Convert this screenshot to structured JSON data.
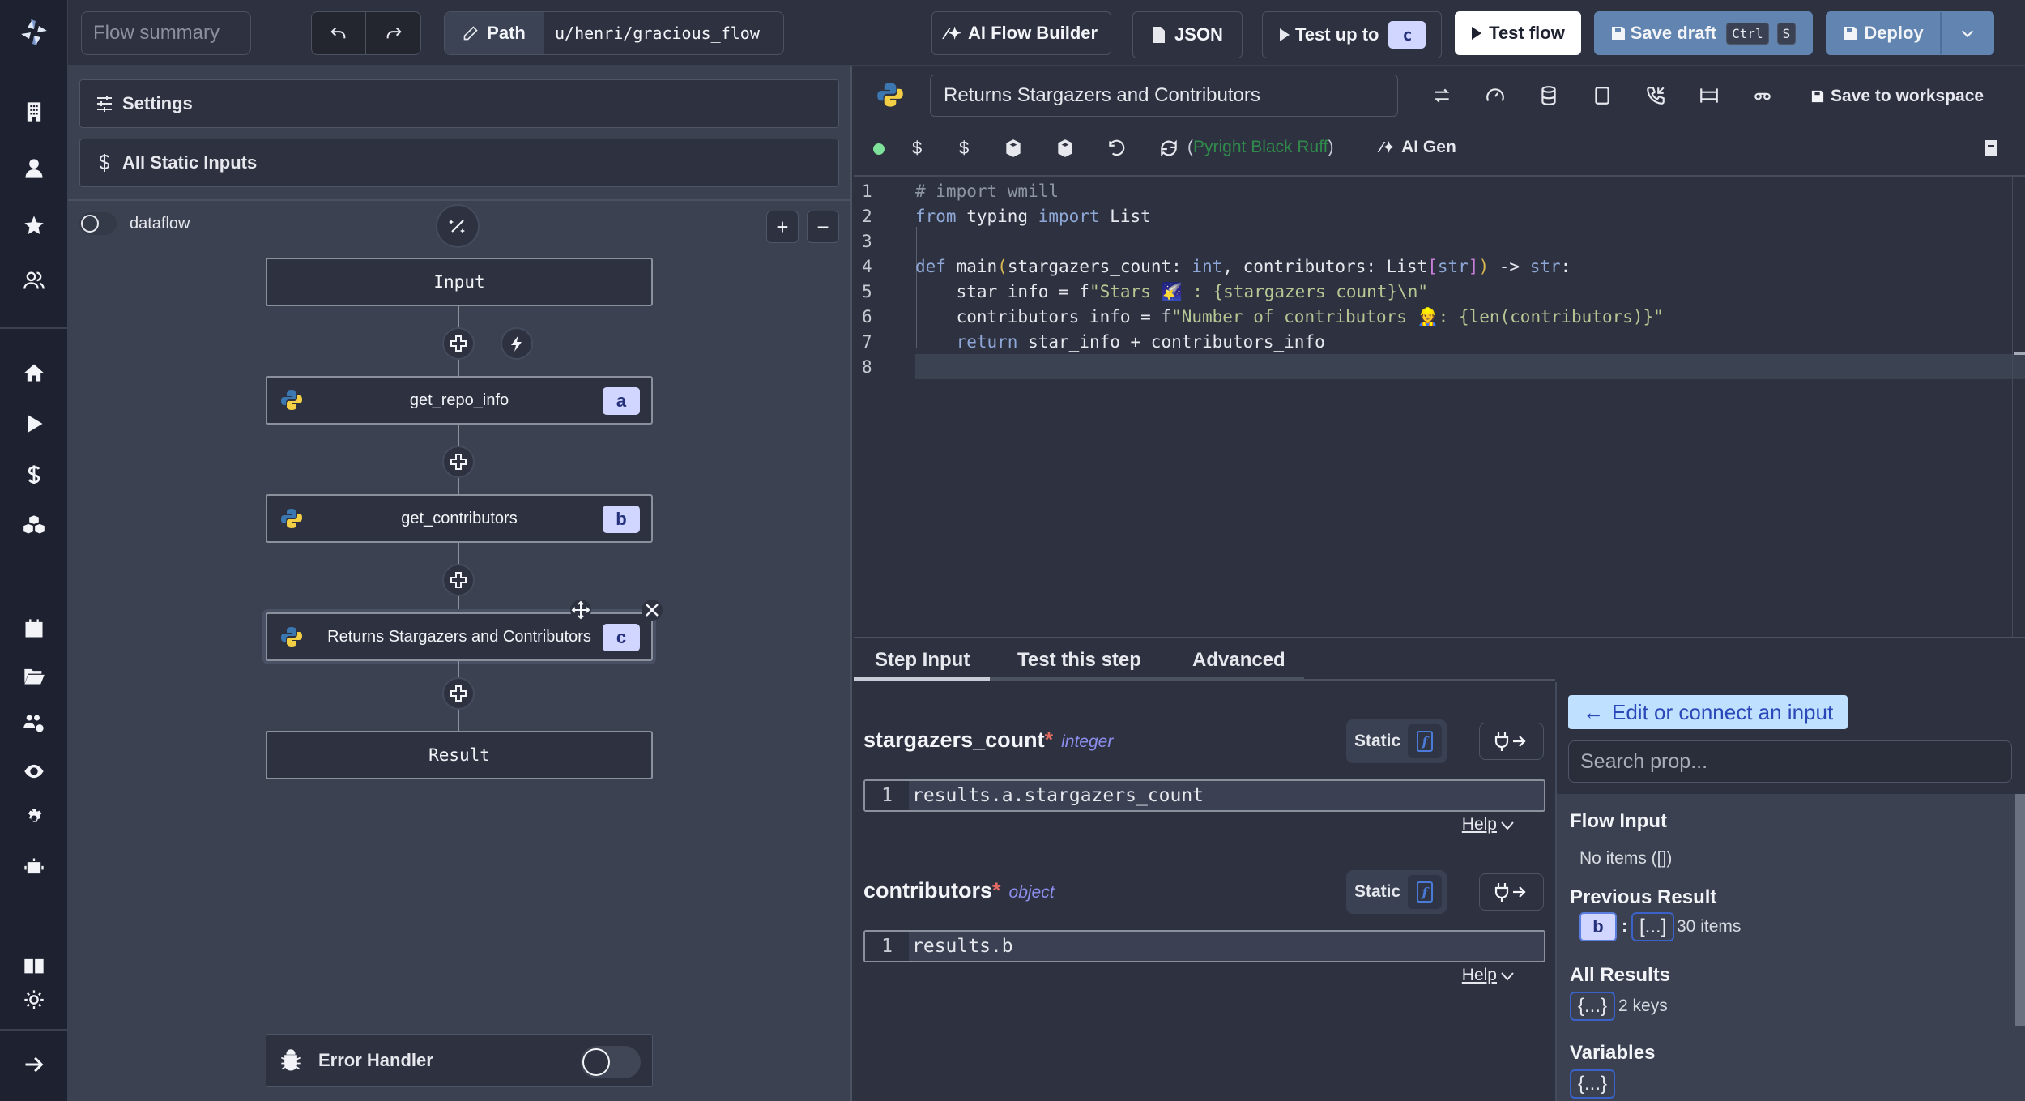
{
  "topbar": {
    "flow_summary_placeholder": "Flow summary",
    "path_label": "Path",
    "path_value": "u/henri/gracious_flow",
    "ai_flow_builder": "AI Flow Builder",
    "json": "JSON",
    "test_up_to": "Test up to",
    "test_up_to_step": "c",
    "test_flow": "Test flow",
    "save_draft": "Save draft",
    "save_draft_kbd1": "Ctrl",
    "save_draft_kbd2": "S",
    "deploy": "Deploy"
  },
  "nav": {
    "items": [
      "workspace-icon",
      "user-icon",
      "star-icon",
      "groups-icon",
      "home-icon",
      "play-icon",
      "dollar-icon",
      "cubes-icon",
      "calendar-icon",
      "folder-icon",
      "users-gear-icon",
      "eye-icon",
      "gear-icon",
      "robot-icon",
      "book-icon",
      "sun-icon",
      "arrow-right-icon"
    ]
  },
  "left": {
    "settings": "Settings",
    "static_inputs": "All Static Inputs",
    "dataflow_label": "dataflow",
    "nodes": [
      {
        "label": "Input"
      },
      {
        "label": "get_repo_info",
        "id": "a"
      },
      {
        "label": "get_contributors",
        "id": "b"
      },
      {
        "label": "Returns Stargazers and Contributors",
        "id": "c"
      },
      {
        "label": "Result"
      }
    ],
    "error_handler": "Error Handler"
  },
  "editor": {
    "step_name": "Returns Stargazers and Contributors",
    "save_to_workspace": "Save to workspace",
    "linters_open": "(",
    "linters": "Pyright Black Ruff",
    "linters_close": ")",
    "ai_gen": "AI Gen",
    "status_color": "#7ee29a",
    "code_lines": [
      "# import wmill",
      "from typing import List",
      "",
      "def main(stargazers_count: int, contributors: List[str]) -> str:",
      "    star_info = f\"Stars 🌠 : {stargazers_count}\\n\"",
      "    contributors_info = f\"Number of contributors 👷: {len(contributors)}\"",
      "    return star_info + contributors_info",
      ""
    ]
  },
  "tabs": [
    "Step Input",
    "Test this step",
    "Advanced"
  ],
  "inputs": [
    {
      "name": "stargazers_count",
      "type": "integer",
      "mode": "Static",
      "line": "1",
      "value": "results.a.stargazers_count",
      "help": "Help"
    },
    {
      "name": "contributors",
      "type": "object",
      "mode": "Static",
      "line": "1",
      "value": "results.b",
      "help": "Help"
    }
  ],
  "props": {
    "edit_connect": "Edit or connect an input",
    "search_placeholder": "Search prop...",
    "flow_input": "Flow Input",
    "flow_input_value": "No items ([])",
    "previous_result": "Previous Result",
    "previous_result_step": "b",
    "previous_result_value": "[...]",
    "previous_result_count": "30 items",
    "all_results": "All Results",
    "all_results_value": "{...}",
    "all_results_count": "2 keys",
    "variables": "Variables",
    "variables_value": "{...}"
  }
}
